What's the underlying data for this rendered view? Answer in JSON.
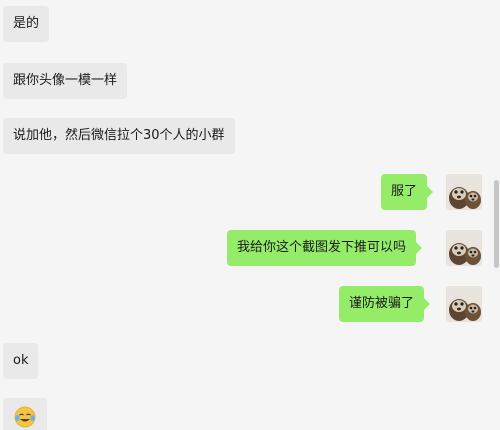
{
  "messages": [
    {
      "side": "in",
      "text": "是的"
    },
    {
      "side": "in",
      "text": "跟你头像一模一样"
    },
    {
      "side": "in",
      "text": "说加他，然后微信拉个30个人的小群"
    },
    {
      "side": "out",
      "text": "服了",
      "avatar": "dog-avatar"
    },
    {
      "side": "out",
      "text": "我给你这个截图发下推可以吗",
      "avatar": "dog-avatar"
    },
    {
      "side": "out",
      "text": "谨防被骗了",
      "avatar": "dog-avatar"
    },
    {
      "side": "in",
      "text": "ok"
    }
  ],
  "emoji": {
    "name": "face-with-tears-emoji"
  },
  "colors": {
    "background": "#f5f5f5",
    "incoming_bubble": "#e9e9e9",
    "outgoing_bubble": "#95ec69",
    "scrollbar": "#c6c6c6"
  }
}
